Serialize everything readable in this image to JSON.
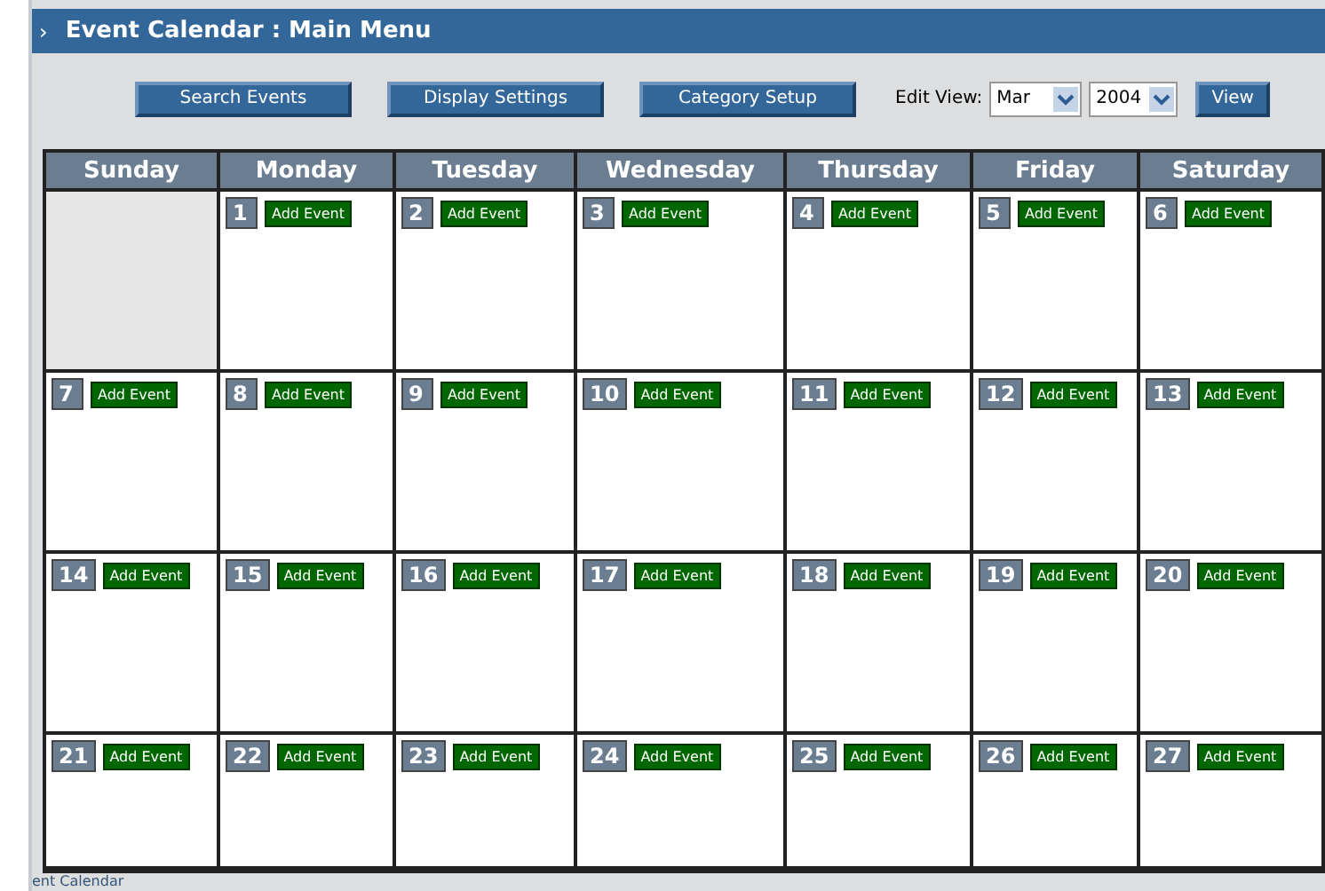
{
  "header": {
    "title": "Event Calendar : Main Menu",
    "bullet": "›"
  },
  "toolbar": {
    "buttons": [
      "Search Events",
      "Display Settings",
      "Category Setup"
    ],
    "edit_view_label": "Edit View:",
    "month": "Mar",
    "year": "2004",
    "view_button": "View"
  },
  "calendar": {
    "weekdays": [
      "Sunday",
      "Monday",
      "Tuesday",
      "Wednesday",
      "Thursday",
      "Friday",
      "Saturday"
    ],
    "weeks": [
      [
        {
          "kind": "empty"
        },
        {
          "kind": "day",
          "day": "1",
          "action": "Add Event"
        },
        {
          "kind": "day",
          "day": "2",
          "action": "Add Event"
        },
        {
          "kind": "day",
          "day": "3",
          "action": "Add Event"
        },
        {
          "kind": "day",
          "day": "4",
          "action": "Add Event"
        },
        {
          "kind": "day",
          "day": "5",
          "action": "Add Event"
        },
        {
          "kind": "day",
          "day": "6",
          "action": "Add Event"
        }
      ],
      [
        {
          "kind": "day",
          "day": "7",
          "action": "Add Event"
        },
        {
          "kind": "day",
          "day": "8",
          "action": "Add Event"
        },
        {
          "kind": "day",
          "day": "9",
          "action": "Add Event"
        },
        {
          "kind": "day",
          "day": "10",
          "action": "Add Event"
        },
        {
          "kind": "day",
          "day": "11",
          "action": "Add Event"
        },
        {
          "kind": "day",
          "day": "12",
          "action": "Add Event"
        },
        {
          "kind": "day",
          "day": "13",
          "action": "Add Event"
        }
      ],
      [
        {
          "kind": "day",
          "day": "14",
          "action": "Add Event"
        },
        {
          "kind": "day",
          "day": "15",
          "action": "Add Event"
        },
        {
          "kind": "day",
          "day": "16",
          "action": "Add Event"
        },
        {
          "kind": "day",
          "day": "17",
          "action": "Add Event"
        },
        {
          "kind": "day",
          "day": "18",
          "action": "Add Event"
        },
        {
          "kind": "day",
          "day": "19",
          "action": "Add Event"
        },
        {
          "kind": "day",
          "day": "20",
          "action": "Add Event"
        }
      ],
      [
        {
          "kind": "day",
          "day": "21",
          "action": "Add Event"
        },
        {
          "kind": "day",
          "day": "22",
          "action": "Add Event"
        },
        {
          "kind": "day",
          "day": "23",
          "action": "Add Event"
        },
        {
          "kind": "day",
          "day": "24",
          "action": "Add Event"
        },
        {
          "kind": "day",
          "day": "25",
          "action": "Add Event"
        },
        {
          "kind": "day",
          "day": "26",
          "action": "Add Event"
        },
        {
          "kind": "day",
          "day": "27",
          "action": "Add Event"
        }
      ]
    ]
  },
  "footer": {
    "text": "ent Calendar"
  }
}
